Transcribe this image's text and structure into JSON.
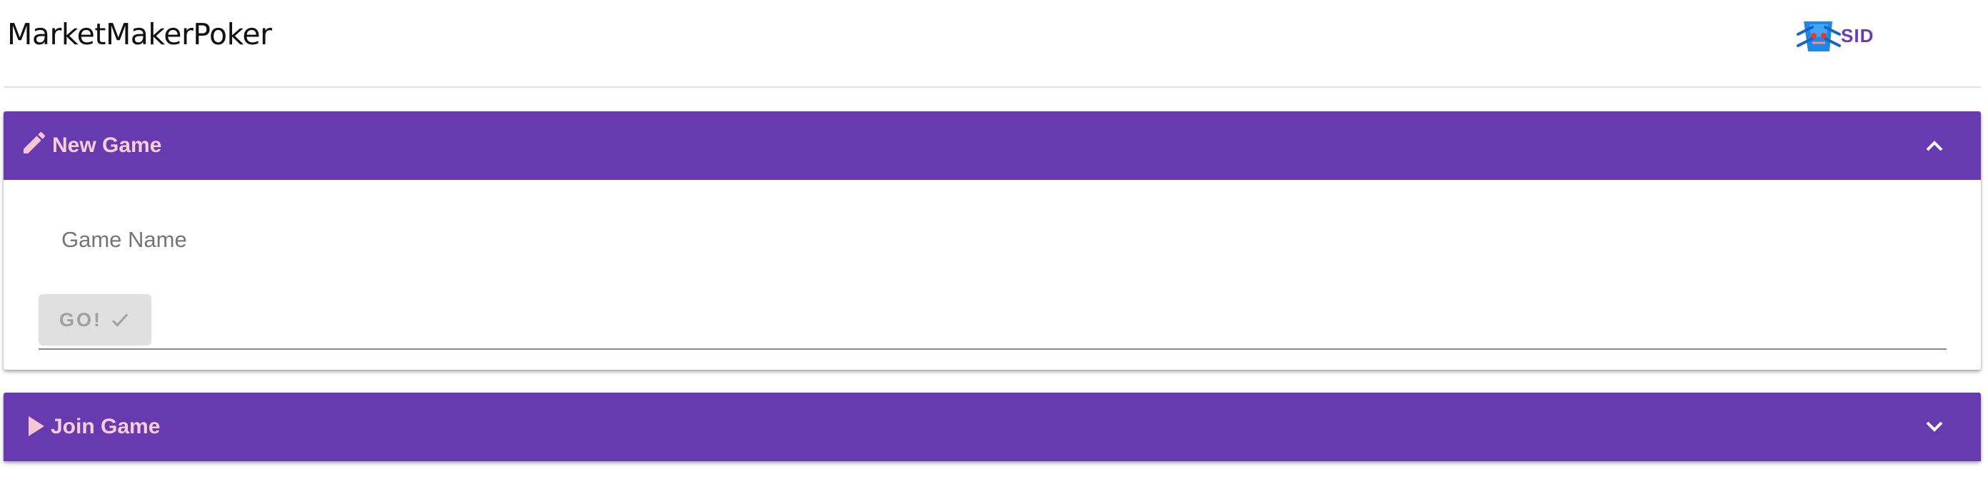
{
  "app": {
    "title": "MarketMakerPoker",
    "user": {
      "name": "SID",
      "logo_icon": "sid-logo-icon"
    }
  },
  "colors": {
    "accent": "#673ab0",
    "header_text": "#f7cdd8",
    "user_text": "#6a3ab2",
    "button_bg": "#e0e0e0",
    "button_text": "#a0a0a0"
  },
  "new_game": {
    "title": "New Game",
    "icon": "pencil-icon",
    "expanded": true,
    "toggle_icon": "chevron-up-icon",
    "game_name_label": "Game Name",
    "game_name_value": "",
    "go_label": "GO!",
    "go_icon": "check-icon",
    "go_enabled": false
  },
  "join_game": {
    "title": "Join Game",
    "icon": "play-icon",
    "expanded": false,
    "toggle_icon": "chevron-down-icon"
  }
}
